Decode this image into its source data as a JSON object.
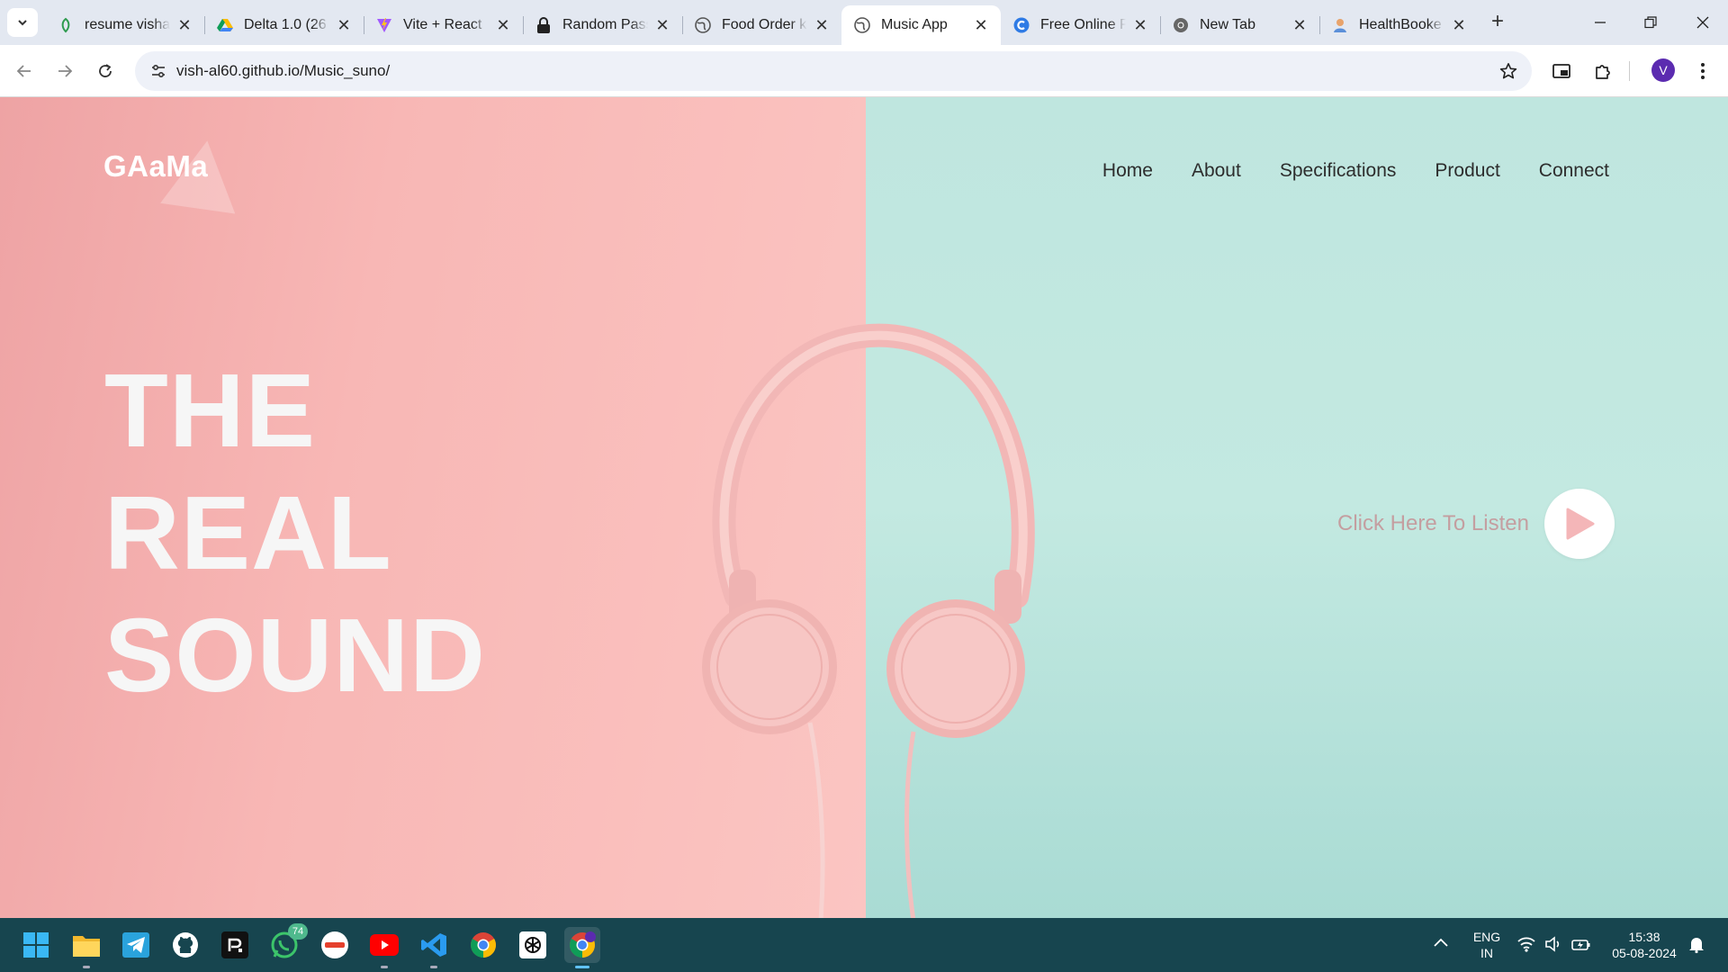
{
  "browser": {
    "tabs": [
      {
        "title": "resume vishal",
        "favicon": "leaf-icon",
        "active": false
      },
      {
        "title": "Delta 1.0 (26",
        "favicon": "google-drive-icon",
        "active": false
      },
      {
        "title": "Vite + React",
        "favicon": "vite-icon",
        "active": false
      },
      {
        "title": "Random Pass",
        "favicon": "lock-icon",
        "active": false
      },
      {
        "title": "Food Order k",
        "favicon": "globe-icon",
        "active": false
      },
      {
        "title": "Music App",
        "favicon": "globe-icon",
        "active": true
      },
      {
        "title": "Free Online P",
        "favicon": "c-logo-icon",
        "active": false
      },
      {
        "title": "New Tab",
        "favicon": "chrome-icon",
        "active": false
      },
      {
        "title": "HealthBooke",
        "favicon": "person-icon",
        "active": false
      }
    ],
    "url": "vish-al60.github.io/Music_suno/",
    "profile_initial": "V"
  },
  "site": {
    "logo": "GAaMa",
    "nav": [
      "Home",
      "About",
      "Specifications",
      "Product",
      "Connect"
    ],
    "hero": [
      "THE",
      "REAL",
      "SOUND"
    ],
    "cta": "Click Here To Listen",
    "colors": {
      "left_bg": "#f8b7b5",
      "right_bg": "#c3e9e1",
      "hero_text": "#f6f6f6",
      "cta_text": "#c49ea0",
      "play_triangle": "#f4b6b8"
    }
  },
  "taskbar": {
    "apps": [
      "windows-start-icon",
      "file-explorer-icon",
      "telegram-icon",
      "github-icon",
      "r-app-icon",
      "whatsapp-icon",
      "coinex-icon",
      "youtube-icon",
      "vscode-icon",
      "chrome-icon",
      "chatgpt-icon",
      "chrome-profile-icon"
    ],
    "whatsapp_badge": "74",
    "language_line1": "ENG",
    "language_line2": "IN",
    "time": "15:38",
    "date": "05-08-2024"
  }
}
